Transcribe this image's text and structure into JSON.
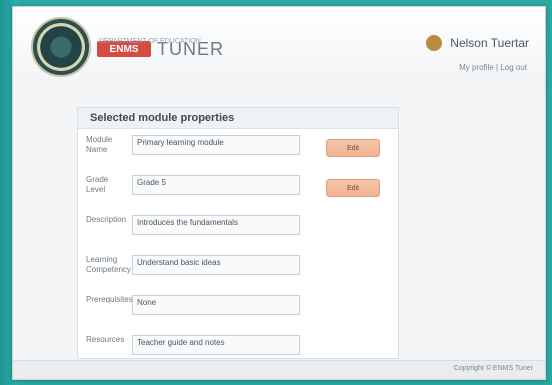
{
  "header": {
    "brand_badge": "ENMS",
    "brand_text": "TUNER",
    "brand_sub": "DEPARTMENT OF EDUCATION",
    "user_name": "Nelson Tuertar",
    "user_links": "My profile | Log out"
  },
  "main": {
    "title": "Selected module properties",
    "rows": [
      {
        "label": "Module Name",
        "value": "Primary learning module",
        "action": "Edit"
      },
      {
        "label": "Grade Level",
        "value": "Grade 5",
        "action": "Edit"
      },
      {
        "label": "Description",
        "value": "Introduces the fundamentals",
        "action": ""
      },
      {
        "label": "Learning Competency",
        "value": "Understand basic ideas",
        "action": ""
      },
      {
        "label": "Prerequisites",
        "value": "None",
        "action": ""
      },
      {
        "label": "Resources",
        "value": "Teacher guide and notes",
        "action": ""
      }
    ]
  },
  "footer": {
    "text": "Copyright © ENMS Tuner"
  },
  "colors": {
    "background": "#2aa8a4",
    "accent": "#d44b44",
    "button": "#f2b18f"
  }
}
